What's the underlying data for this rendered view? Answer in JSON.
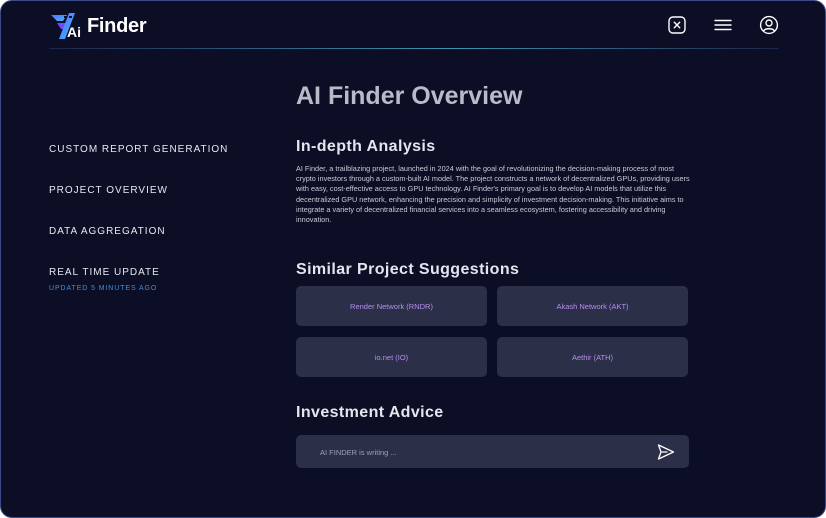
{
  "header": {
    "logo_text": "Finder",
    "logo_mark_text": "Ai",
    "icons": [
      "close-square-icon",
      "menu-icon",
      "user-circle-icon"
    ]
  },
  "sidebar": {
    "items": [
      {
        "label": "CUSTOM REPORT GENERATION"
      },
      {
        "label": "PROJECT OVERVIEW"
      },
      {
        "label": "DATA AGGREGATION"
      },
      {
        "label": "REAL TIME UPDATE",
        "sub": "UPDATED 5 MINUTES AGO"
      }
    ]
  },
  "main": {
    "title": "AI Finder Overview",
    "analysis": {
      "title": "In-depth Analysis",
      "text": "AI Finder, a trailblazing project, launched in 2024 with the goal of revolutionizing the decision-making process of most crypto investors through a custom-built AI model. The project constructs a network of decentralized GPUs, providing users with easy, cost-effective access to GPU technology. AI Finder's primary goal is to develop AI models that utilize this decentralized GPU network, enhancing the precision and simplicity of investment decision-making. This initiative aims to integrate a variety of decentralized financial services into a seamless ecosystem, fostering accessibility and driving innovation."
    },
    "similar": {
      "title": "Similar Project Suggestions",
      "cards": [
        {
          "label": "Render Network (RNDR)"
        },
        {
          "label": "Akash Network (AKT)"
        },
        {
          "label": "io.net (IO)"
        },
        {
          "label": "Aethir (ATH)"
        }
      ]
    },
    "advice": {
      "title": "Investment Advice",
      "placeholder": "AI FINDER is writing ...",
      "value": ""
    }
  },
  "colors": {
    "background": "#0b0e24",
    "card": "#2b2f48",
    "accent_purple": "#b98cf0",
    "accent_blue": "#3d8fe0",
    "frame_border": "#3a4a8a"
  }
}
